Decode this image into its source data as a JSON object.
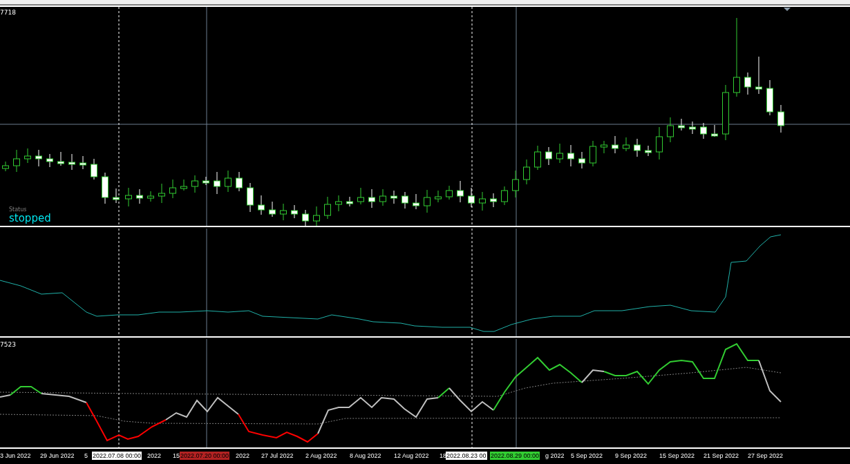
{
  "main_pane": {
    "corner_value": "7718",
    "status_label": "Status",
    "status_value": "stopped"
  },
  "indicator_pane": {
    "corner_value": "7523"
  },
  "time_axis": {
    "labels": [
      "3 Jun 2022",
      "29 Jun 2022",
      "5",
      "2022",
      "15",
      "2022",
      "27 Jul 2022",
      "2 Aug 2022",
      "8 Aug 2022",
      "12 Aug 2022",
      "18",
      "g 2022",
      "5 Sep 2022",
      "9 Sep 2022",
      "15 Sep 2022",
      "21 Sep 2022",
      "27 Sep 2022"
    ],
    "markers": [
      {
        "text": "2022.07.08 00:00",
        "color": "#ffffff"
      },
      {
        "text": "2022.07.20 00:00",
        "color": "#b22222"
      },
      {
        "text": "2022.08.23 00",
        "color": "#ffffff"
      },
      {
        "text": "2022.08.29 00:00",
        "color": "#32cd32"
      }
    ]
  }
}
